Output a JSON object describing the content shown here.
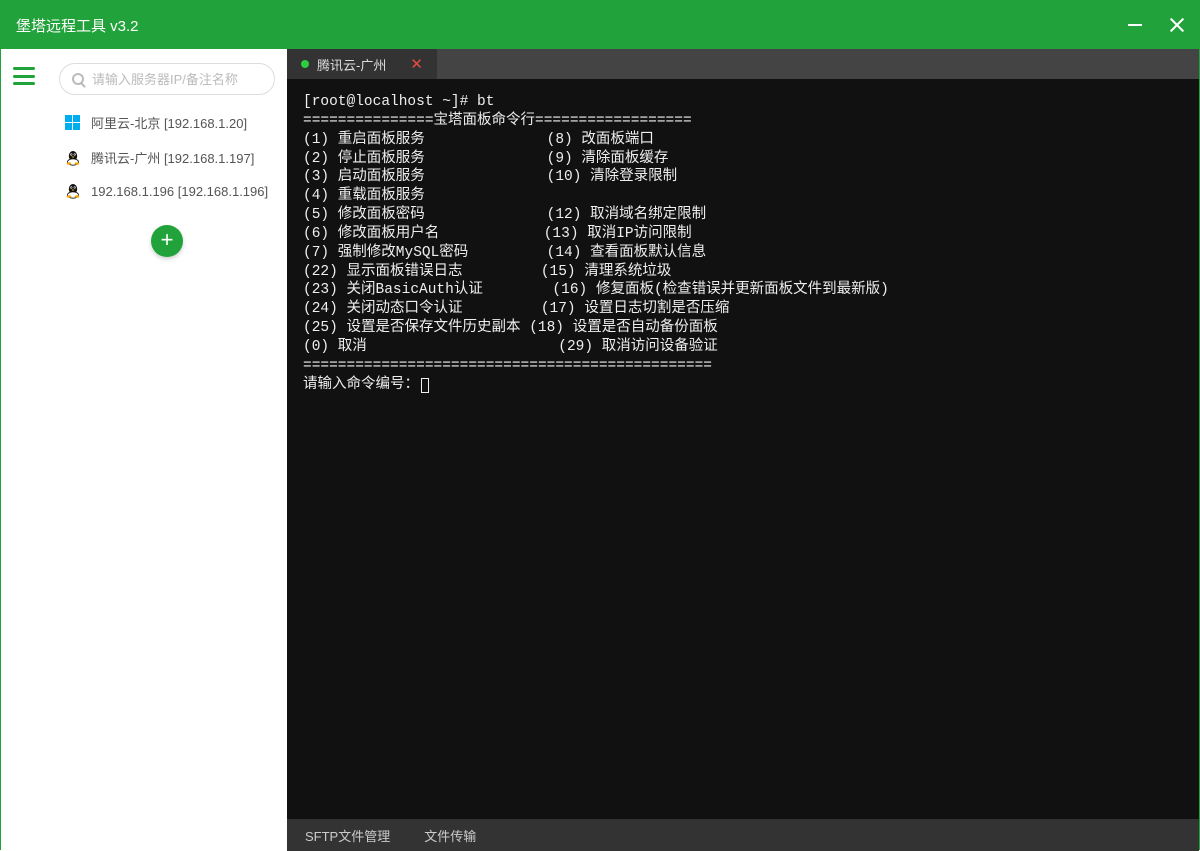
{
  "titlebar": {
    "title": "堡塔远程工具 v3.2"
  },
  "sidebar": {
    "search_placeholder": "请输入服务器IP/备注名称",
    "servers": [
      {
        "os": "windows",
        "label": "阿里云-北京 [192.168.1.20]"
      },
      {
        "os": "linux",
        "label": "腾讯云-广州 [192.168.1.197]"
      },
      {
        "os": "linux",
        "label": "192.168.1.196 [192.168.1.196]"
      }
    ]
  },
  "tab": {
    "label": "腾讯云-广州"
  },
  "terminal": {
    "prompt_user": "[root@localhost ~]#",
    "prompt_cmd": "bt",
    "divider_top": "===============宝塔面板命令行==================",
    "rows_left": [
      "(1) 重启面板服务",
      "(2) 停止面板服务",
      "(3) 启动面板服务",
      "(4) 重载面板服务",
      "(5) 修改面板密码",
      "(6) 修改面板用户名",
      "(7) 强制修改MySQL密码",
      "(22) 显示面板错误日志",
      "(23) 关闭BasicAuth认证",
      "(24) 关闭动态口令认证",
      "(25) 设置是否保存文件历史副本",
      "(0) 取消"
    ],
    "rows_right": [
      "(8) 改面板端口",
      "(9) 清除面板缓存",
      "(10) 清除登录限制",
      "",
      "(12) 取消域名绑定限制",
      "(13) 取消IP访问限制",
      "(14) 查看面板默认信息",
      "(15) 清理系统垃圾",
      "(16) 修复面板(检查错误并更新面板文件到最新版)",
      "(17) 设置日志切割是否压缩",
      "(18) 设置是否自动备份面板",
      "(29) 取消访问设备验证"
    ],
    "divider_bottom": "===============================================",
    "input_prompt": "请输入命令编号："
  },
  "statusbar": {
    "sftp": "SFTP文件管理",
    "transfer": "文件传输"
  }
}
